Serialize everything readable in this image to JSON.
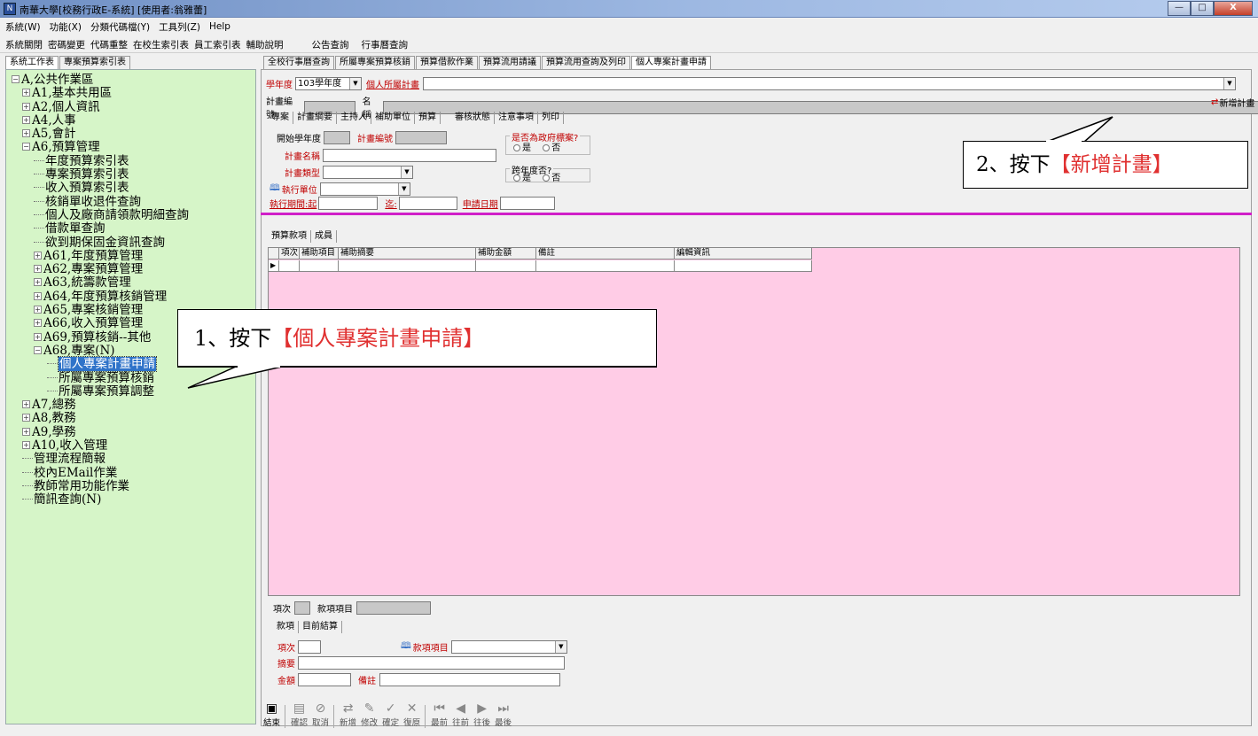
{
  "window": {
    "title": "南華大學[校務行政E-系統] [使用者:翁雅蕾]",
    "min": "—",
    "max": "□",
    "close": "X"
  },
  "menubar": [
    "系統(W)",
    "功能(X)",
    "分類代碼檔(Y)",
    "工具列(Z)",
    "Help"
  ],
  "toolbar": [
    "系統關閉",
    "密碼變更",
    "代碼重整",
    "在校生索引表",
    "員工索引表",
    "輔助說明",
    "公告查詢",
    "行事曆查詢"
  ],
  "left_tabs": [
    "系統工作表",
    "專案預算索引表"
  ],
  "tree": [
    {
      "label": "A,公共作業區",
      "level": 0,
      "type": "minus"
    },
    {
      "label": "A1,基本共用區",
      "level": 1,
      "type": "plus"
    },
    {
      "label": "A2,個人資訊",
      "level": 1,
      "type": "plus"
    },
    {
      "label": "A4,人事",
      "level": 1,
      "type": "plus"
    },
    {
      "label": "A5,會計",
      "level": 1,
      "type": "plus"
    },
    {
      "label": "A6,預算管理",
      "level": 1,
      "type": "minus"
    },
    {
      "label": "年度預算索引表",
      "level": 2,
      "type": "leaf"
    },
    {
      "label": "專案預算索引表",
      "level": 2,
      "type": "leaf"
    },
    {
      "label": "收入預算索引表",
      "level": 2,
      "type": "leaf"
    },
    {
      "label": "核銷單收退件查詢",
      "level": 2,
      "type": "leaf"
    },
    {
      "label": "個人及廠商請領款明細查詢",
      "level": 2,
      "type": "leaf"
    },
    {
      "label": "借款單查詢",
      "level": 2,
      "type": "leaf"
    },
    {
      "label": "欲到期保固金資訊查詢",
      "level": 2,
      "type": "leaf"
    },
    {
      "label": "A61,年度預算管理",
      "level": 2,
      "type": "plus"
    },
    {
      "label": "A62,專案預算管理",
      "level": 2,
      "type": "plus"
    },
    {
      "label": "A63,統籌款管理",
      "level": 2,
      "type": "plus"
    },
    {
      "label": "A64,年度預算核銷管理",
      "level": 2,
      "type": "plus"
    },
    {
      "label": "A65,專案核銷管理",
      "level": 2,
      "type": "plus"
    },
    {
      "label": "A66,收入預算管理",
      "level": 2,
      "type": "plus"
    },
    {
      "label": "A69,預算核銷--其他",
      "level": 2,
      "type": "plus"
    },
    {
      "label": "A68,專案(N)",
      "level": 2,
      "type": "minus"
    },
    {
      "label": "個人專案計畫申請",
      "level": 3,
      "type": "leaf",
      "selected": true
    },
    {
      "label": "所屬專案預算核銷",
      "level": 3,
      "type": "leaf"
    },
    {
      "label": "所屬專案預算調整",
      "level": 3,
      "type": "leaf"
    },
    {
      "label": "A7,總務",
      "level": 1,
      "type": "plus"
    },
    {
      "label": "A8,教務",
      "level": 1,
      "type": "plus"
    },
    {
      "label": "A9,學務",
      "level": 1,
      "type": "plus"
    },
    {
      "label": "A10,收入管理",
      "level": 1,
      "type": "plus"
    },
    {
      "label": "管理流程簡報",
      "level": 1,
      "type": "leaf"
    },
    {
      "label": "校內EMail作業",
      "level": 1,
      "type": "leaf"
    },
    {
      "label": "教師常用功能作業",
      "level": 1,
      "type": "leaf"
    },
    {
      "label": "簡訊查詢(N)",
      "level": 1,
      "type": "leaf"
    }
  ],
  "top_tabs": [
    "全校行事曆查詢",
    "所屬專案預算核銷",
    "預算借款作業",
    "預算流用請議",
    "預算流用查詢及列印",
    "個人專案計畫申請"
  ],
  "form": {
    "year_label": "學年度",
    "year_value": "103學年度",
    "personal_plan_label": "個人所屬計畫",
    "plan_no_label": "計畫編號",
    "name_label": "名稱",
    "new_plan_label": "新增計畫",
    "subtabs": [
      "專案",
      "計畫綱要",
      "主持人",
      "補助單位",
      "預算",
      "審核狀態",
      "注意事項",
      "列印"
    ],
    "start_year_label": "開始學年度",
    "plan_code_label": "計畫編號",
    "gov_label": "是否為政府標案?",
    "yes": "是",
    "no": "否",
    "plan_name_label": "計畫名稱",
    "plan_type_label": "計畫類型",
    "cross_year_label": "跨年度否?",
    "exec_unit_label": "執行單位",
    "period_start_label": "執行期間:起",
    "period_end_label": "迄:",
    "apply_date_label": "申請日期"
  },
  "budget": {
    "tabs": [
      "預算款項",
      "成員"
    ],
    "columns": [
      "項次",
      "補助項目",
      "補助摘要",
      "補助金額",
      "備註",
      "編輯資訊"
    ],
    "item_no_label": "項次",
    "item_label": "款項項目",
    "lower_tabs": [
      "款項",
      "目前結算"
    ],
    "lower_item_no": "項次",
    "lower_item": "款項項目",
    "summary_label": "摘要",
    "amount_label": "金額",
    "note_label": "備註"
  },
  "bottom_toolbar": [
    {
      "label": "結束",
      "icon": "exit-icon"
    },
    {
      "label": "確認",
      "icon": "confirm-icon"
    },
    {
      "label": "取消",
      "icon": "cancel-icon"
    },
    {
      "label": "新增",
      "icon": "add-icon"
    },
    {
      "label": "修改",
      "icon": "edit-icon"
    },
    {
      "label": "確定",
      "icon": "check-icon"
    },
    {
      "label": "復原",
      "icon": "undo-icon"
    },
    {
      "label": "最前",
      "icon": "first-icon"
    },
    {
      "label": "往前",
      "icon": "prev-icon"
    },
    {
      "label": "往後",
      "icon": "next-icon"
    },
    {
      "label": "最後",
      "icon": "last-icon"
    }
  ],
  "callout1": {
    "prefix": "1、按下",
    "highlight": "【個人專案計畫申請】"
  },
  "callout2": {
    "prefix": "2、按下",
    "highlight": "【新增計畫】"
  }
}
